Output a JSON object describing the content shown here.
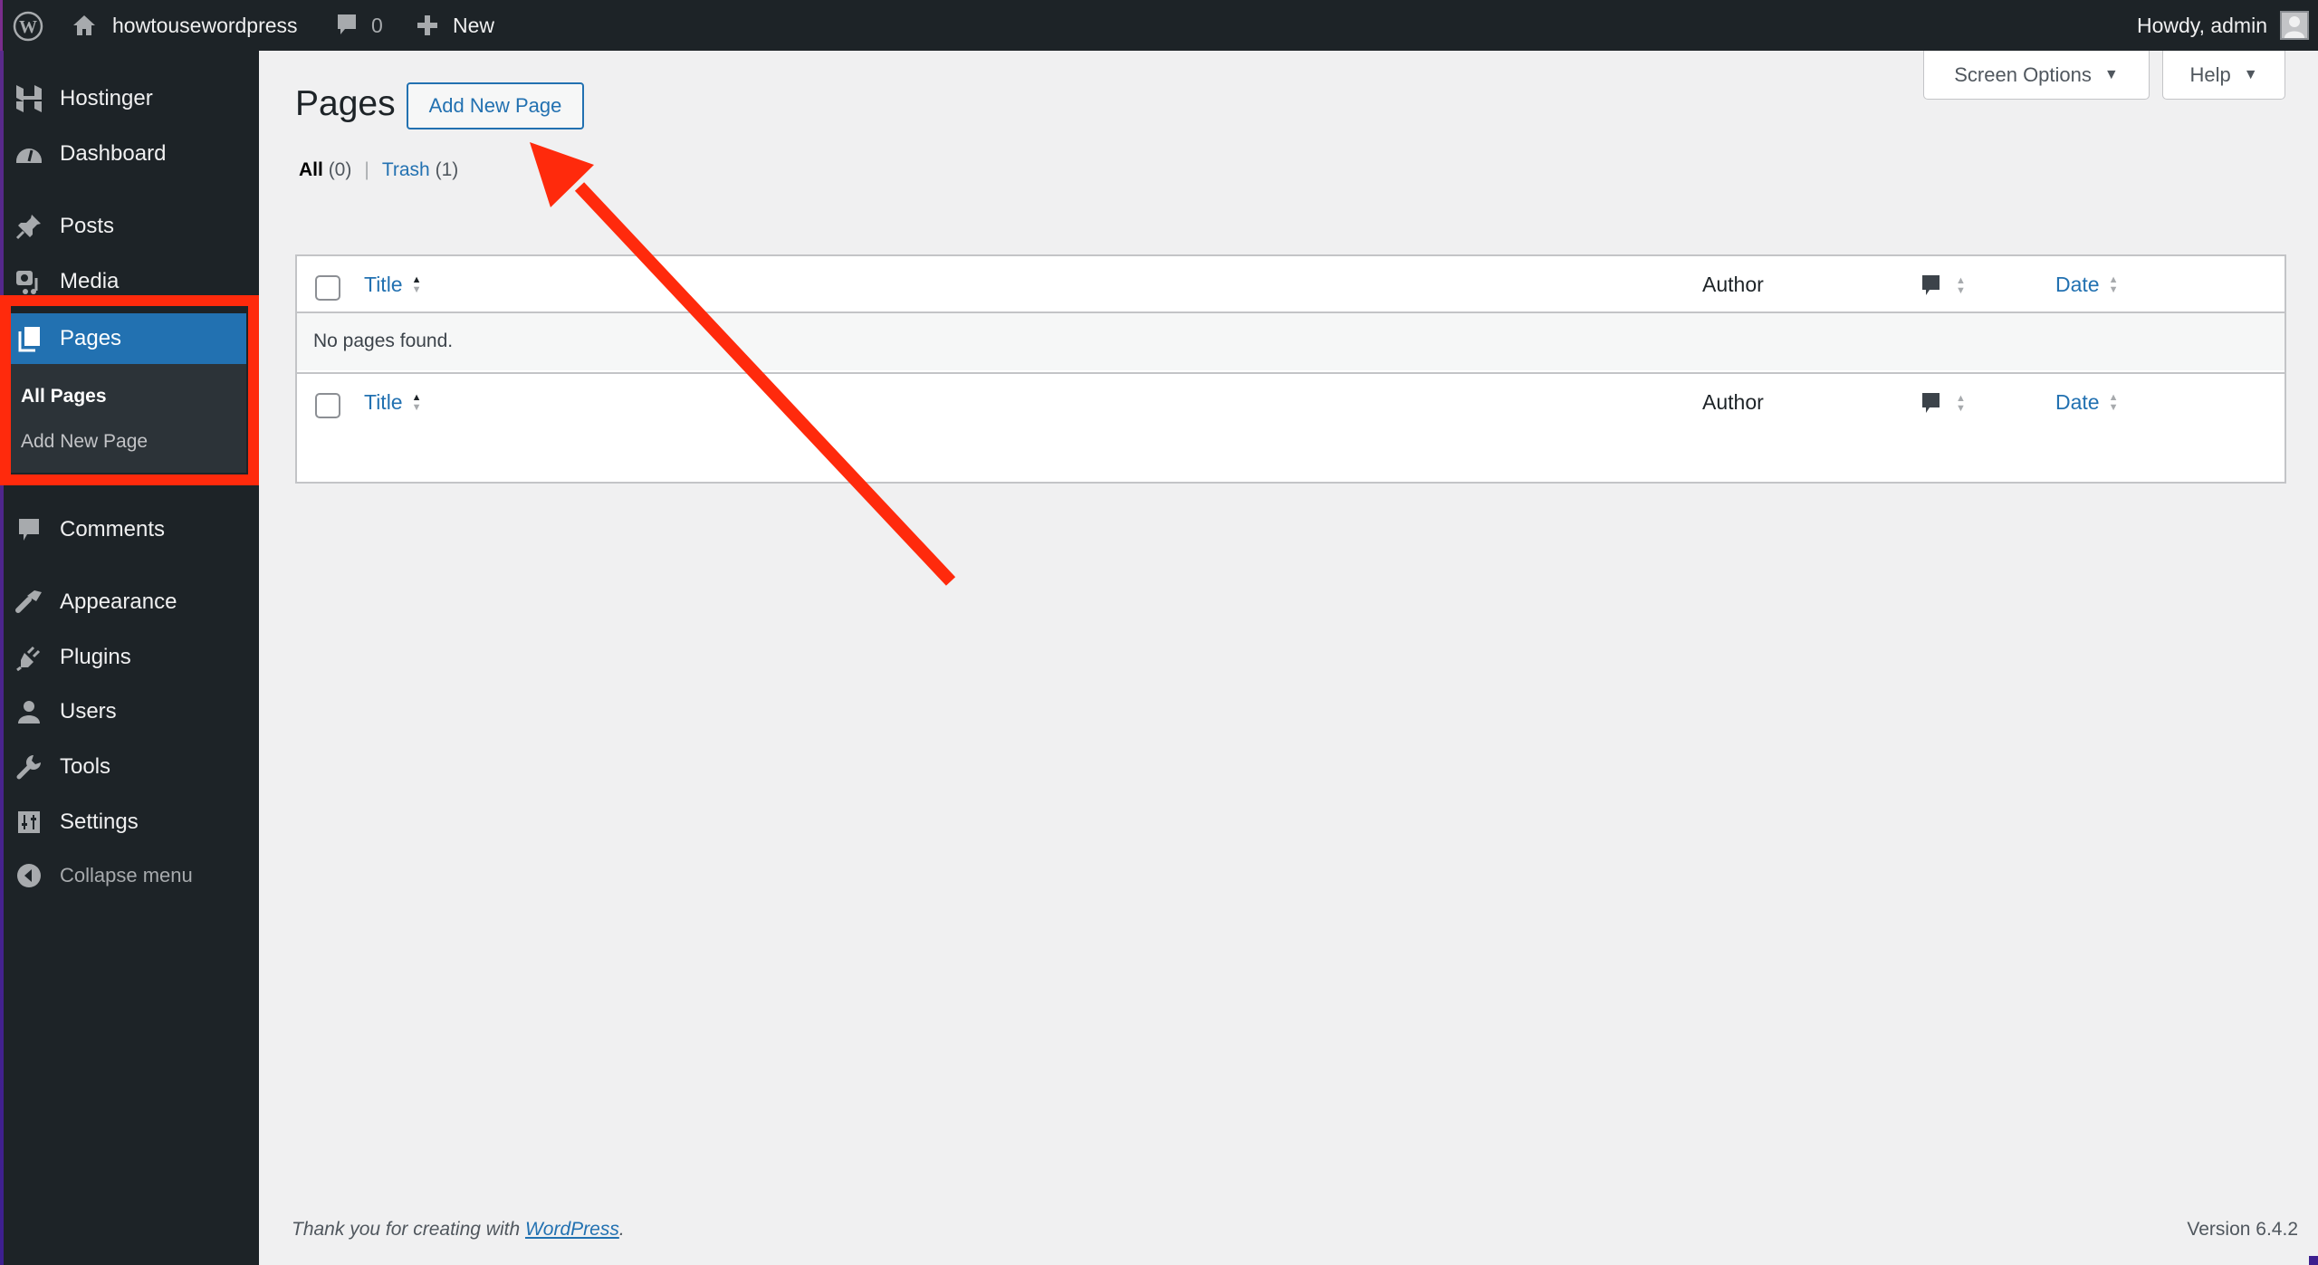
{
  "admin_bar": {
    "site_name": "howtousewordpress",
    "comments_count": "0",
    "new_label": "New",
    "greeting": "Howdy, admin"
  },
  "sidebar": {
    "items": [
      {
        "label": "Hostinger",
        "icon": "hostinger-icon"
      },
      {
        "label": "Dashboard",
        "icon": "dashboard-icon"
      },
      {
        "label": "Posts",
        "icon": "pin-icon"
      },
      {
        "label": "Media",
        "icon": "media-icon"
      },
      {
        "label": "Pages",
        "icon": "pages-icon",
        "current": true
      },
      {
        "label": "Comments",
        "icon": "comment-icon"
      },
      {
        "label": "Appearance",
        "icon": "paintbrush-icon"
      },
      {
        "label": "Plugins",
        "icon": "plug-icon"
      },
      {
        "label": "Users",
        "icon": "user-icon"
      },
      {
        "label": "Tools",
        "icon": "wrench-icon"
      },
      {
        "label": "Settings",
        "icon": "settings-icon"
      }
    ],
    "submenu": [
      {
        "label": "All Pages",
        "active": true
      },
      {
        "label": "Add New Page",
        "active": false
      }
    ],
    "collapse_label": "Collapse menu"
  },
  "header": {
    "screen_options_label": "Screen Options",
    "help_label": "Help",
    "page_title": "Pages",
    "add_new_label": "Add New Page"
  },
  "filters": {
    "all_label": "All",
    "all_count": "(0)",
    "separator": "|",
    "trash_label": "Trash",
    "trash_count": "(1)"
  },
  "table": {
    "columns": {
      "title": "Title",
      "author": "Author",
      "date": "Date"
    },
    "empty_message": "No pages found."
  },
  "footer": {
    "thanks_prefix": "Thank you for creating with ",
    "thanks_link": "WordPress",
    "thanks_suffix": ".",
    "version": "Version 6.4.2"
  },
  "annotation": {
    "highlight_color": "#ff2a0c",
    "arrow_color": "#ff2a0c",
    "arrow_target": "Add New Page"
  }
}
